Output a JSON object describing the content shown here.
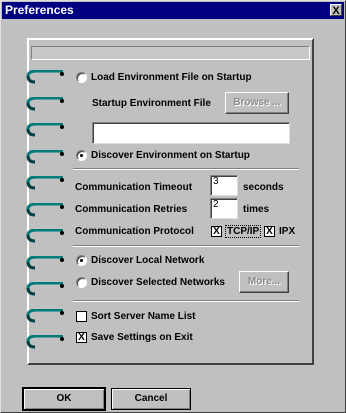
{
  "window": {
    "title": "Preferences",
    "close_label": "X"
  },
  "options": {
    "load_env_label": "Load Environment File on Startup",
    "load_env_selected": false,
    "startup_env_file_label": "Startup Environment File",
    "browse_label": "Browse ...",
    "startup_env_file_value": "",
    "discover_env_label": "Discover Environment on Startup",
    "discover_env_selected": true,
    "comm_timeout_label": "Communication Timeout",
    "comm_timeout_value": "3",
    "comm_timeout_unit": "seconds",
    "comm_retries_label": "Communication Retries",
    "comm_retries_value": "2",
    "comm_retries_unit": "times",
    "comm_protocol_label": "Communication Protocol",
    "tcpip_label": "TCP/IP",
    "tcpip_checked": true,
    "ipx_label": "IPX",
    "ipx_checked": true,
    "discover_local_label": "Discover Local Network",
    "discover_local_selected": true,
    "discover_selected_label": "Discover Selected Networks",
    "discover_selected_selected": false,
    "more_label": "More...",
    "sort_server_label": "Sort Server Name List",
    "sort_server_checked": false,
    "save_settings_label": "Save Settings on Exit",
    "save_settings_checked": true,
    "check_mark": "X"
  },
  "buttons": {
    "ok_label": "OK",
    "cancel_label": "Cancel"
  },
  "colors": {
    "titlebar": "#000080",
    "face": "#c0c0c0",
    "ring": "#007a7a"
  }
}
